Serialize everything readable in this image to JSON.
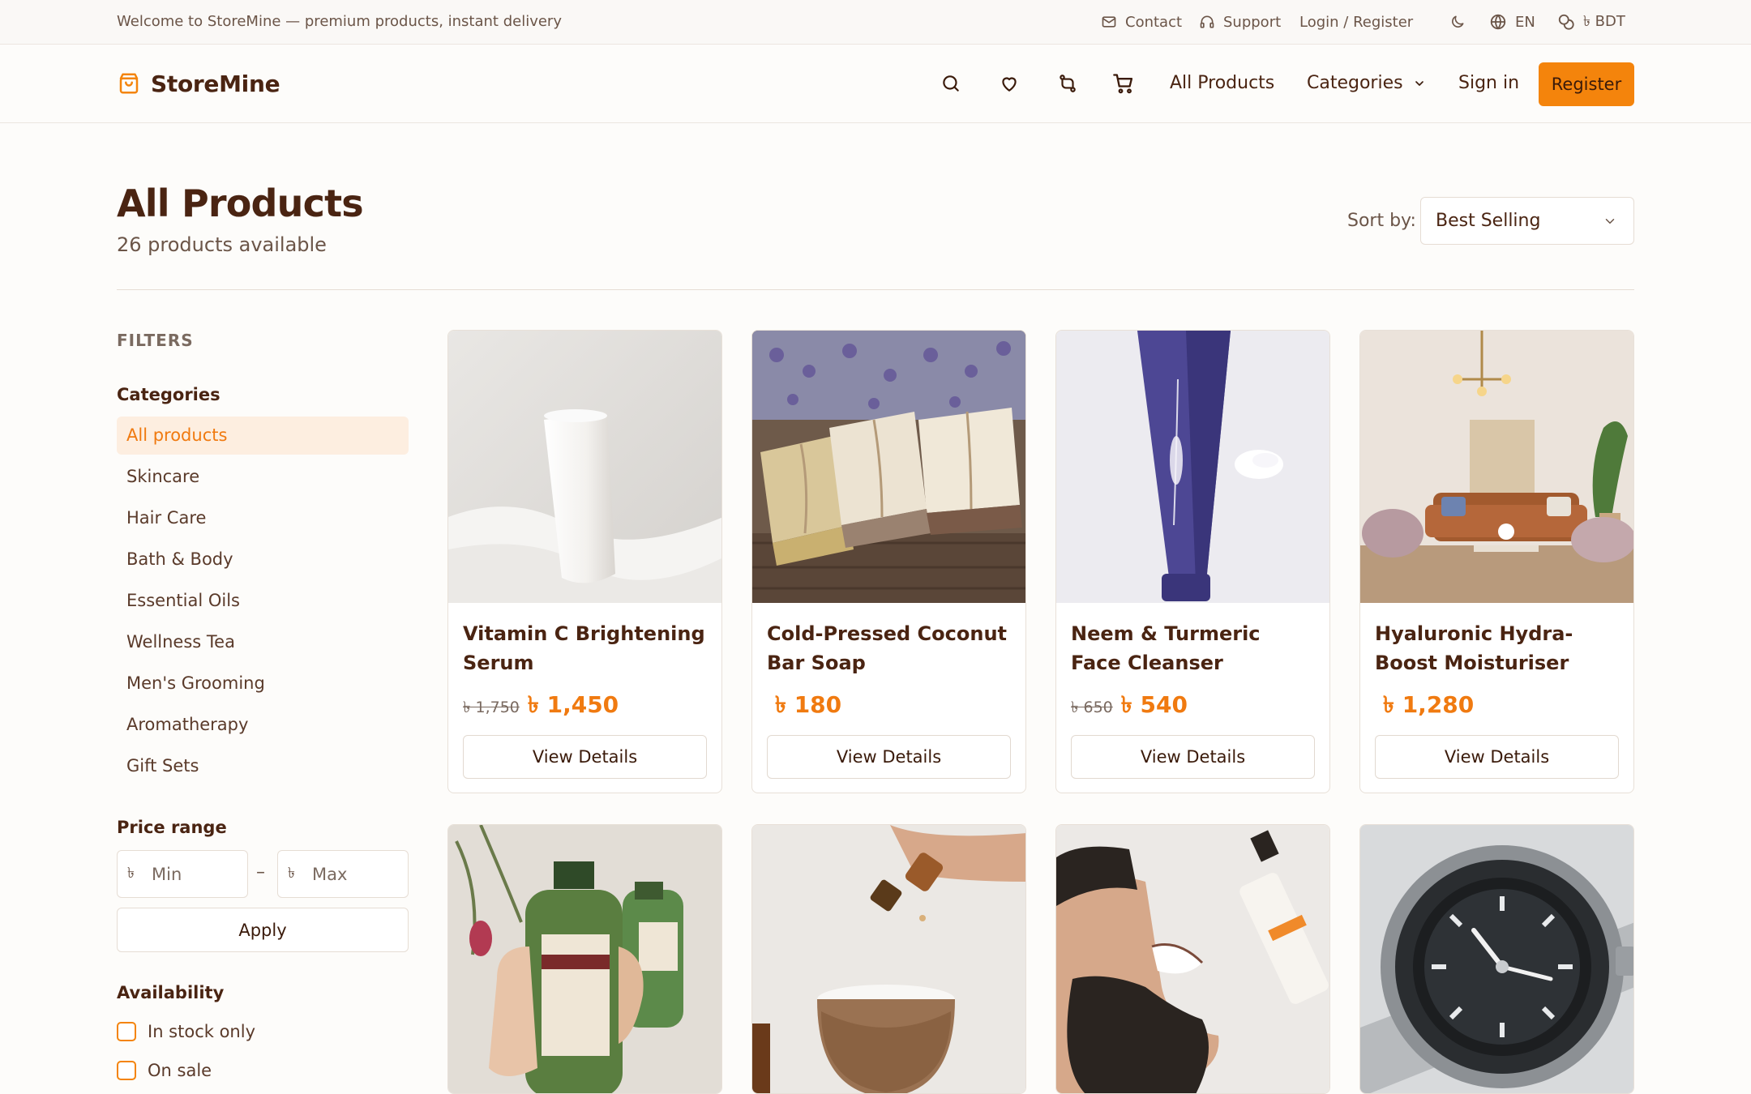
{
  "topbar": {
    "welcome": "Welcome to StoreMine — premium products, instant delivery",
    "contact": "Contact",
    "support": "Support",
    "login": "Login / Register",
    "language": "EN",
    "currency": "৳ BDT"
  },
  "header": {
    "brand": "StoreMine",
    "nav_all_products": "All Products",
    "nav_categories": "Categories",
    "sign_in": "Sign in",
    "register": "Register"
  },
  "page": {
    "title": "All Products",
    "count": "26 products available",
    "sort_label": "Sort by:",
    "sort_value": "Best Selling"
  },
  "filters": {
    "title": "FILTERS",
    "categories_heading": "Categories",
    "categories": [
      "All products",
      "Skincare",
      "Hair Care",
      "Bath & Body",
      "Essential Oils",
      "Wellness Tea",
      "Men's Grooming",
      "Aromatherapy",
      "Gift Sets"
    ],
    "active_category": "All products",
    "price_heading": "Price range",
    "currency_symbol": "৳",
    "min_placeholder": "Min",
    "max_placeholder": "Max",
    "separator": "–",
    "apply": "Apply",
    "availability_heading": "Availability",
    "in_stock": "In stock only",
    "on_sale": "On sale"
  },
  "products": [
    {
      "name": "Vitamin C Brightening Serum",
      "old_price": "৳ 1,750",
      "price": "৳ 1,450",
      "button": "View Details"
    },
    {
      "name": "Cold-Pressed Coconut Bar Soap",
      "old_price": "",
      "price": "৳ 180",
      "button": "View Details"
    },
    {
      "name": "Neem & Turmeric Face Cleanser",
      "old_price": "৳ 650",
      "price": "৳ 540",
      "button": "View Details"
    },
    {
      "name": "Hyaluronic Hydra-Boost Moisturiser",
      "old_price": "",
      "price": "৳ 1,280",
      "button": "View Details"
    }
  ],
  "colors": {
    "accent": "#f4840c",
    "accent_text": "#f07a10",
    "brown_text": "#4a2412",
    "muted_text": "#6b5548"
  }
}
